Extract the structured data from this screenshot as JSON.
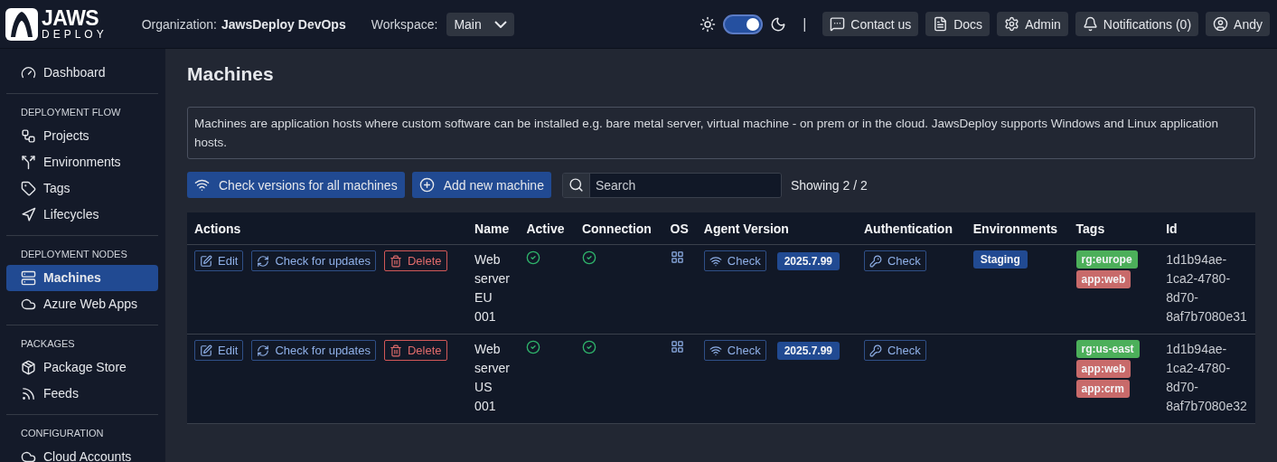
{
  "header": {
    "logo_top": "JAWS",
    "logo_bottom": "DEPLOY",
    "organization_label": "Organization:",
    "organization": "JawsDeploy DevOps",
    "workspace_label": "Workspace:",
    "workspace": "Main",
    "dark_mode": true,
    "separator": "|",
    "buttons": [
      {
        "kind": "contact",
        "label": "Contact us"
      },
      {
        "kind": "docs",
        "label": "Docs"
      },
      {
        "kind": "admin",
        "label": "Admin"
      },
      {
        "kind": "bell",
        "label": "Notifications (0)"
      },
      {
        "kind": "user",
        "label": "Andy"
      }
    ]
  },
  "sidebar": {
    "sections": [
      {
        "items": [
          {
            "kind": "gauge",
            "label": "Dashboard",
            "selected": false
          }
        ]
      },
      {
        "title": "DEPLOYMENT FLOW",
        "items": [
          {
            "kind": "projects",
            "label": "Projects",
            "selected": false
          },
          {
            "kind": "split",
            "label": "Environments",
            "selected": false
          },
          {
            "kind": "tag",
            "label": "Tags",
            "selected": false
          },
          {
            "kind": "diamond",
            "label": "Lifecycles",
            "selected": false
          }
        ]
      },
      {
        "title": "DEPLOYMENT NODES",
        "items": [
          {
            "kind": "machine",
            "label": "Machines",
            "selected": true
          },
          {
            "kind": "cloud",
            "label": "Azure Web Apps",
            "selected": false
          }
        ]
      },
      {
        "title": "PACKAGES",
        "items": [
          {
            "kind": "package",
            "label": "Package Store",
            "selected": false
          },
          {
            "kind": "rss",
            "label": "Feeds",
            "selected": false
          }
        ]
      },
      {
        "title": "CONFIGURATION",
        "items": [
          {
            "kind": "cloud",
            "label": "Cloud Accounts",
            "selected": false
          }
        ]
      }
    ]
  },
  "page": {
    "title": "Machines",
    "description": "Machines are application hosts where custom software can be installed e.g. bare metal server, virtual machine - on prem or in the cloud. JawsDeploy supports Windows and Linux application hosts.",
    "toolbar": {
      "check_all": "Check versions for all machines",
      "add": "Add new machine",
      "search_placeholder": "Search",
      "count": "Showing 2 / 2"
    }
  },
  "table": {
    "columns": [
      "Actions",
      "Name",
      "Active",
      "Connection",
      "OS",
      "Agent Version",
      "Authentication",
      "Environments",
      "Tags",
      "Id"
    ],
    "rows": [
      {
        "actions": [
          {
            "kind": "edit",
            "label": "Edit"
          },
          {
            "kind": "update",
            "label": "Check for updates"
          },
          {
            "kind": "delete",
            "label": "Delete"
          }
        ],
        "agent_check": "Check",
        "auth_check": "Check",
        "name": "Web server EU 001",
        "active": true,
        "connected": true,
        "os": {
          "kind": "windows"
        },
        "version": "2025.7.99",
        "environments": [
          "Staging"
        ],
        "tags": [
          {
            "label": "rg:europe",
            "color": "#4caf5a"
          },
          {
            "label": "app:web",
            "color": "#c86a6a"
          }
        ],
        "id": "1d1b94ae-1ca2-4780-8d70-8af7b7080e31"
      },
      {
        "actions": [
          {
            "kind": "edit",
            "label": "Edit"
          },
          {
            "kind": "update",
            "label": "Check for updates"
          },
          {
            "kind": "delete",
            "label": "Delete"
          }
        ],
        "agent_check": "Check",
        "auth_check": "Check",
        "name": "Web server US 001",
        "active": true,
        "connected": true,
        "os": {
          "kind": "windows"
        },
        "version": "2025.7.99",
        "environments": [],
        "tags": [
          {
            "label": "rg:us-east",
            "color": "#4caf5a"
          },
          {
            "label": "app:web",
            "color": "#c86a6a"
          },
          {
            "label": "app:crm",
            "color": "#c86a6a"
          }
        ],
        "id": "1d1b94ae-1ca2-4780-8d70-8af7b7080e32"
      }
    ]
  }
}
